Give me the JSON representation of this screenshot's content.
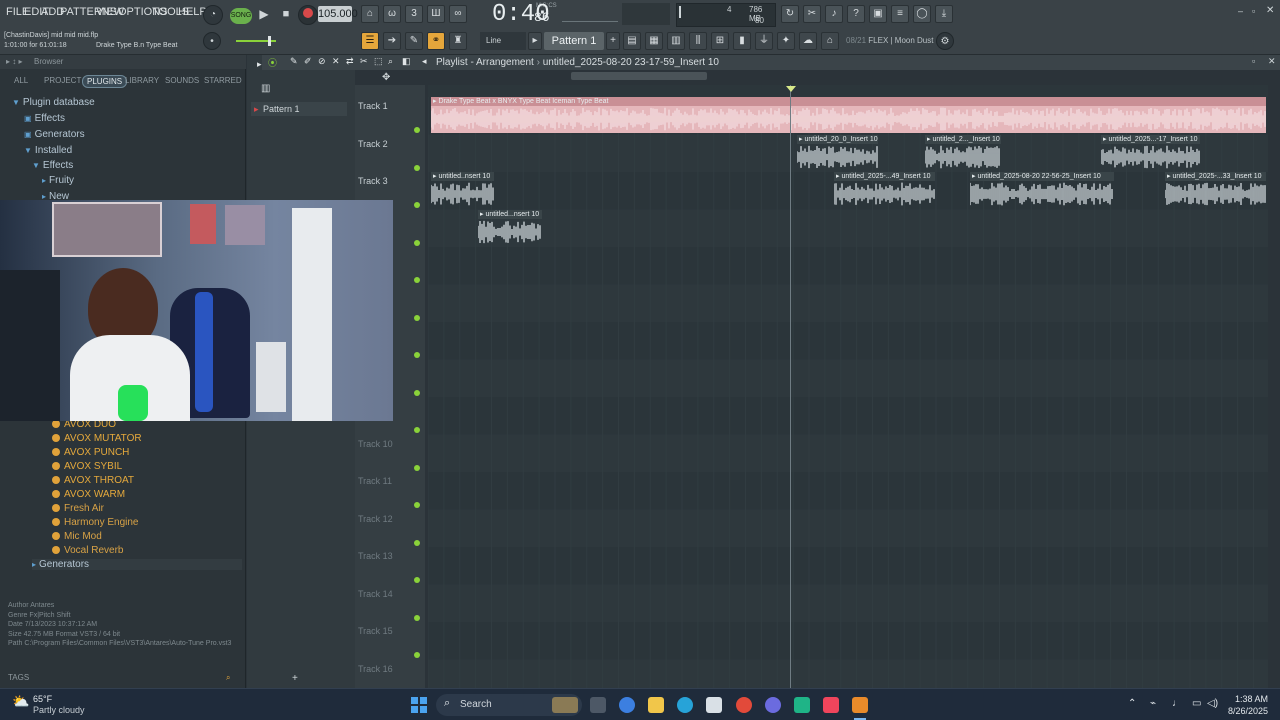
{
  "menu": [
    "FILE",
    "EDIT",
    "ADD",
    "PATTERNS",
    "VIEW",
    "OPTIONS",
    "TOOLS",
    "HELP"
  ],
  "transport": {
    "song_label": "SONG",
    "tempo": "105.000",
    "time": "0:40",
    "time_ms": "86",
    "time_unit": "M:S:CS"
  },
  "cpu": {
    "num1": "4",
    "mem": "786 MB",
    "num2": "80"
  },
  "hint": {
    "file_line": "[ChastinDavis] mid mid mid.flp",
    "range_line": "1:01:00 for 61:01:18",
    "beat_label": "Drake Type B.n Type Beat"
  },
  "toolbar2": {
    "line_label": "Line",
    "pattern_label": "Pattern 1",
    "news": "08/21",
    "news_text": "FLEX | Moon Dust"
  },
  "browser": {
    "header": "Browser",
    "tabs": [
      "ALL",
      "PROJECT",
      "PLUGINS",
      "LIBRARY",
      "SOUNDS",
      "STARRED"
    ],
    "tree": [
      "Plugin database",
      "Effects",
      "Generators",
      "Installed",
      "Effects",
      "Fruity",
      "New"
    ],
    "plugins": [
      "AVOX DUO",
      "AVOX MUTATOR",
      "AVOX PUNCH",
      "AVOX SYBIL",
      "AVOX THROAT",
      "AVOX WARM",
      "Fresh Air",
      "Harmony Engine",
      "Mic Mod",
      "Vocal Reverb"
    ],
    "generators": "Generators",
    "info": {
      "author_label": "Author",
      "author": "Antares",
      "genre_label": "Genre",
      "genre": "Fx|Pitch Shift",
      "date_label": "Date",
      "date": "7/13/2023 10:37:12 AM",
      "size_label": "Size",
      "size": "42.75 MB",
      "format_label": "Format",
      "format": "VST3 / 64 bit",
      "path_label": "Path",
      "path": "C:\\Program Files\\Common Files\\VST3\\Antares\\Auto-Tune Pro.vst3"
    },
    "tags": "TAGS"
  },
  "pattern_list": [
    "Pattern 1"
  ],
  "playlist": {
    "title": "Playlist - Arrangement",
    "breadcrumb": "untitled_2025-08-20 23-17-59_Insert 10",
    "bars": [
      "14",
      "15",
      "16",
      "17",
      "18",
      "19",
      "20",
      "21",
      "22",
      "23",
      "24",
      "25",
      "26"
    ],
    "tracks": [
      "Track 1",
      "Track 2",
      "Track 3",
      "",
      "",
      "",
      "",
      "",
      "",
      "Track 10",
      "Track 11",
      "Track 12",
      "Track 13",
      "Track 14",
      "Track 15",
      "Track 16"
    ],
    "clips": {
      "t1": "Drake Type Beat x BNYX Type Beat  Iceman Type Beat",
      "t2a": "untitled_20_0_Insert 10",
      "t2b": "untitled_2..._Insert 10",
      "t2c": "untitled_2025...-17_Insert 10",
      "t3a": "untitled..nsert 10",
      "t3b": "untitled_2025-...49_Insert 10",
      "t3c": "untitled_2025-08-20 22-56-25_Insert 10",
      "t3d": "untitled_2025-...33_Insert 10",
      "t4a": "untitled...nsert 10"
    }
  },
  "taskbar": {
    "weather_temp": "65°F",
    "weather_desc": "Partly cloudy",
    "search": "Search",
    "time": "1:38 AM",
    "date": "8/26/2025"
  },
  "colors": {
    "accent_green": "#8ad23a",
    "clip_pink": "#e5b7bb",
    "clip_gray": "#c7cfd3",
    "folder": "#e1a23a"
  }
}
